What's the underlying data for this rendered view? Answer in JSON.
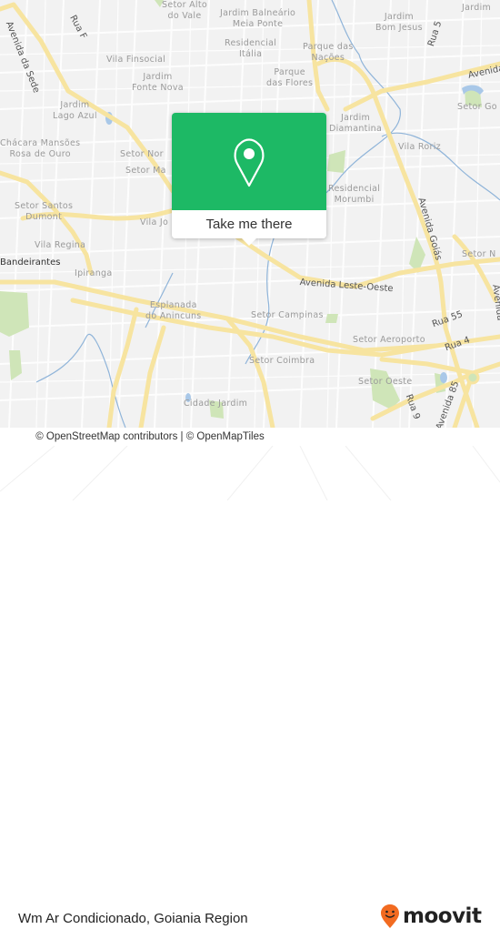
{
  "map": {
    "neighborhoods": [
      {
        "id": "setor-alto-do-vale",
        "lines": [
          "Setor Alto",
          "do Vale"
        ]
      },
      {
        "id": "jardim-balneario-meia-ponte",
        "lines": [
          "Jardim Balneário",
          "Meia Ponte"
        ]
      },
      {
        "id": "jardim-bom-jesus",
        "lines": [
          "Jardim",
          "Bom Jesus"
        ]
      },
      {
        "id": "jardim-ne",
        "lines": [
          "Jardim"
        ]
      },
      {
        "id": "residencial-italia",
        "lines": [
          "Residencial",
          "Itália"
        ]
      },
      {
        "id": "parque-das-nacoes",
        "lines": [
          "Parque das",
          "Nações"
        ]
      },
      {
        "id": "vila-finsocial",
        "lines": [
          "Vila Finsocial"
        ]
      },
      {
        "id": "jardim-fonte-nova",
        "lines": [
          "Jardim",
          "Fonte Nova"
        ]
      },
      {
        "id": "parque-das-flores",
        "lines": [
          "Parque",
          "das Flores"
        ]
      },
      {
        "id": "jardim-lago-azul",
        "lines": [
          "Jardim",
          "Lago Azul"
        ]
      },
      {
        "id": "setor-goiania",
        "lines": [
          "Setor Go"
        ]
      },
      {
        "id": "chacara-mansoes",
        "lines": [
          "Chácara Mansões",
          "Rosa de Ouro"
        ]
      },
      {
        "id": "setor-norte",
        "lines": [
          "Setor Nor"
        ]
      },
      {
        "id": "setor-ma",
        "lines": [
          "Setor Ma"
        ]
      },
      {
        "id": "jardim-diamantina",
        "lines": [
          "Jardim",
          "Diamantina"
        ]
      },
      {
        "id": "vila-roriz",
        "lines": [
          "Vila Roriz"
        ]
      },
      {
        "id": "residencial-morumbi",
        "lines": [
          "Residencial",
          "Morumbi"
        ]
      },
      {
        "id": "setor-santos-dumont",
        "lines": [
          "Setor Santos",
          "Dumont"
        ]
      },
      {
        "id": "vila-jo",
        "lines": [
          "Vila Jo"
        ]
      },
      {
        "id": "vila-regina",
        "lines": [
          "Vila Regina"
        ]
      },
      {
        "id": "setor-n",
        "lines": [
          "Setor N"
        ]
      },
      {
        "id": "ipiranga",
        "lines": [
          "Ipiranga"
        ]
      },
      {
        "id": "esplanada-do-anincuns",
        "lines": [
          "Esplanada",
          "do Anincuns"
        ]
      },
      {
        "id": "setor-campinas",
        "lines": [
          "Setor Campinas"
        ]
      },
      {
        "id": "setor-aeroporto",
        "lines": [
          "Setor Aeroporto"
        ]
      },
      {
        "id": "setor-coimbra",
        "lines": [
          "Setor Coimbra"
        ]
      },
      {
        "id": "setor-oeste",
        "lines": [
          "Setor Oeste"
        ]
      },
      {
        "id": "cidade-jardim",
        "lines": [
          "Cidade Jardim"
        ]
      }
    ],
    "roads": {
      "avenida_da_sede": "Avenida da Sede",
      "rua_f": "Rua F",
      "rua_5": "Rua 5",
      "avenida_ne": "Avenida",
      "bandeirantes": "Bandeirantes",
      "avenida_leste_oeste": "Avenida Leste-Oeste",
      "avenida_goias": "Avenida Goiás",
      "avenida_e": "Avenida",
      "rua_55": "Rua 55",
      "rua_4": "Rua 4",
      "rua_9": "Rua 9",
      "avenida_85": "Avenida 85"
    },
    "colors": {
      "land": "#f2f2f2",
      "road_major": "#f7e4a0",
      "road_minor": "#ffffff",
      "water": "#8fb4d9",
      "park": "#cfe5b8"
    }
  },
  "popup": {
    "icon": "map-pin-icon",
    "action_label": "Take me there",
    "accent": "#1db965"
  },
  "attribution": "© OpenStreetMap contributors | © OpenMapTiles",
  "footer": {
    "place_title": "Wm Ar Condicionado, Goiania Region",
    "logo_text": "moovit",
    "logo_icon": "moovit-smiley-pin-icon",
    "logo_color": "#f26b21"
  }
}
